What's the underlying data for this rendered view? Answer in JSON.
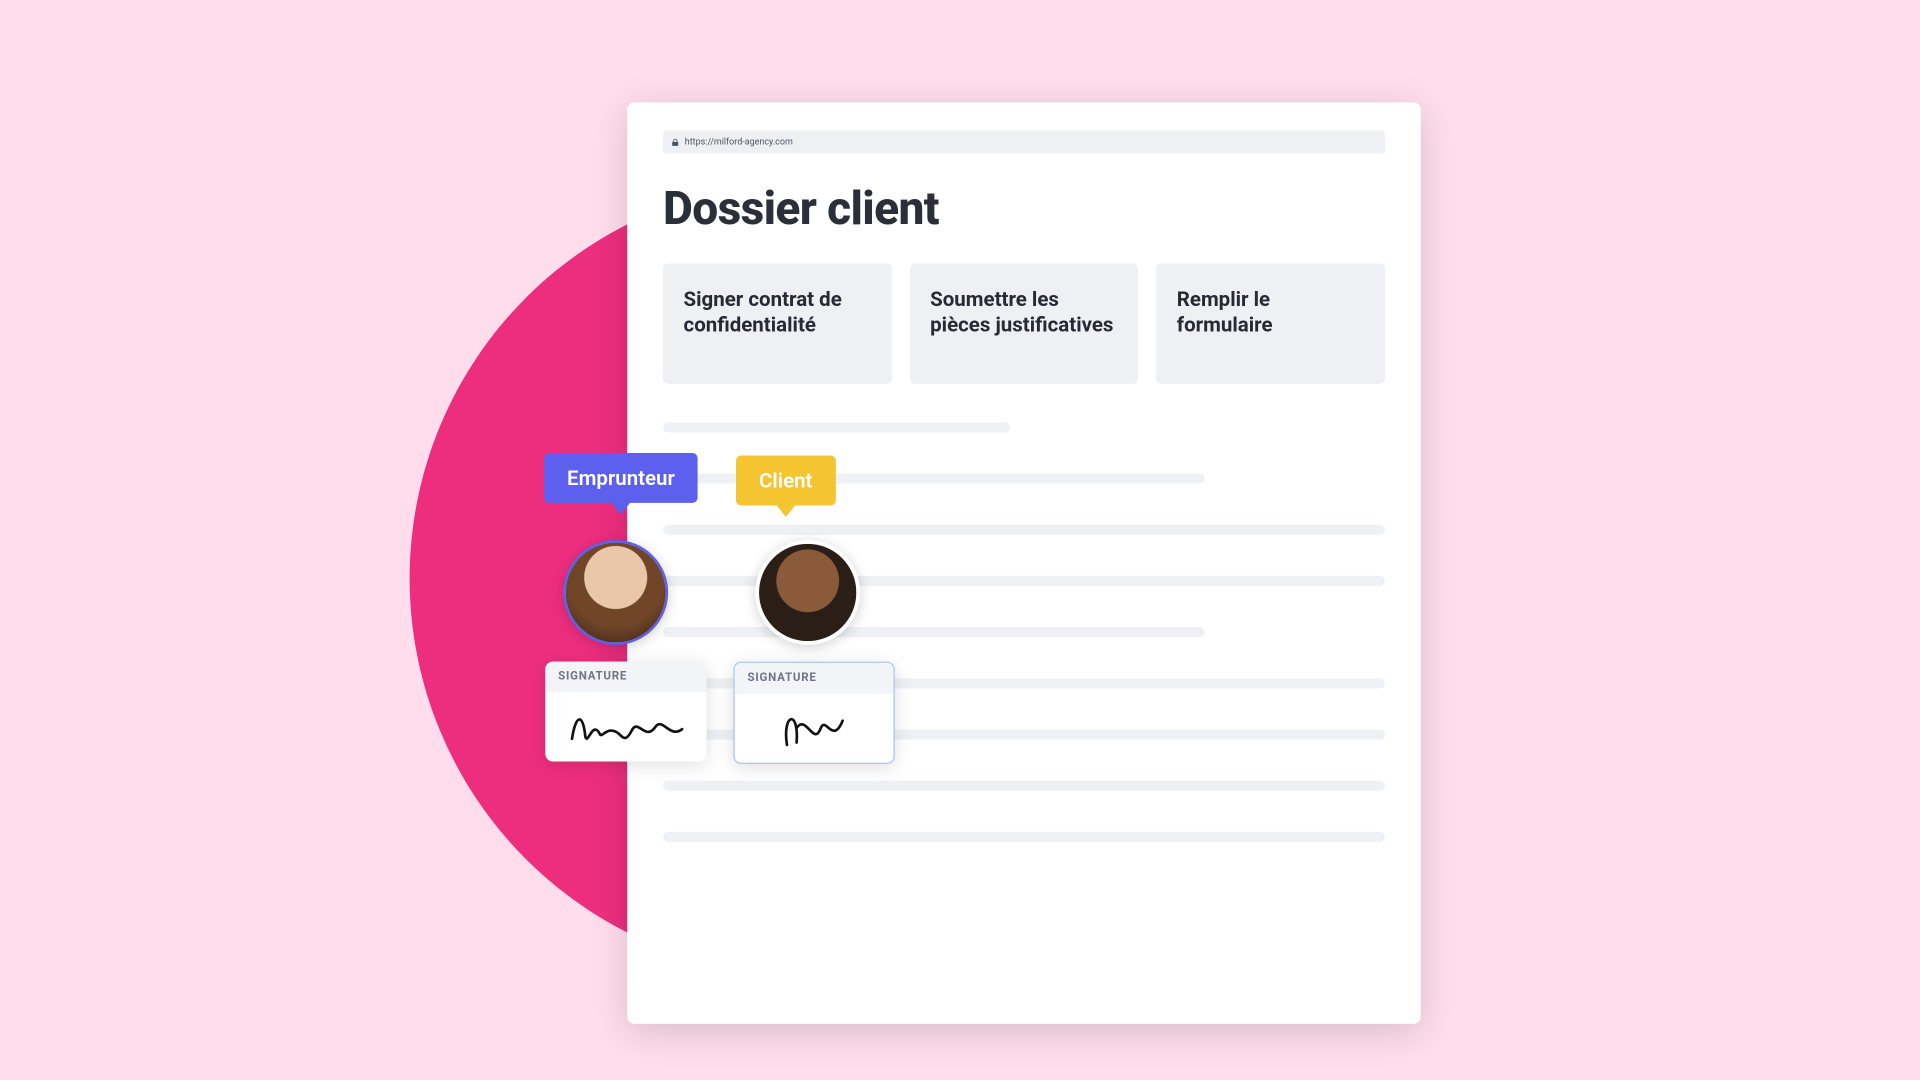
{
  "url_bar": {
    "url": "https://milford-agency.com"
  },
  "page": {
    "title": "Dossier client"
  },
  "tasks": [
    {
      "title": "Signer contrat de confidentialité"
    },
    {
      "title": "Soumettre les pièces justificatives"
    },
    {
      "title": "Remplir le formulaire"
    }
  ],
  "roles": {
    "borrower": {
      "label": "Emprunteur",
      "color": "#5D5FEF"
    },
    "client": {
      "label": "Client",
      "color": "#F4C431"
    }
  },
  "signatures": {
    "borrower": {
      "label": "SIGNATURE"
    },
    "client": {
      "label": "SIGNATURE"
    }
  }
}
